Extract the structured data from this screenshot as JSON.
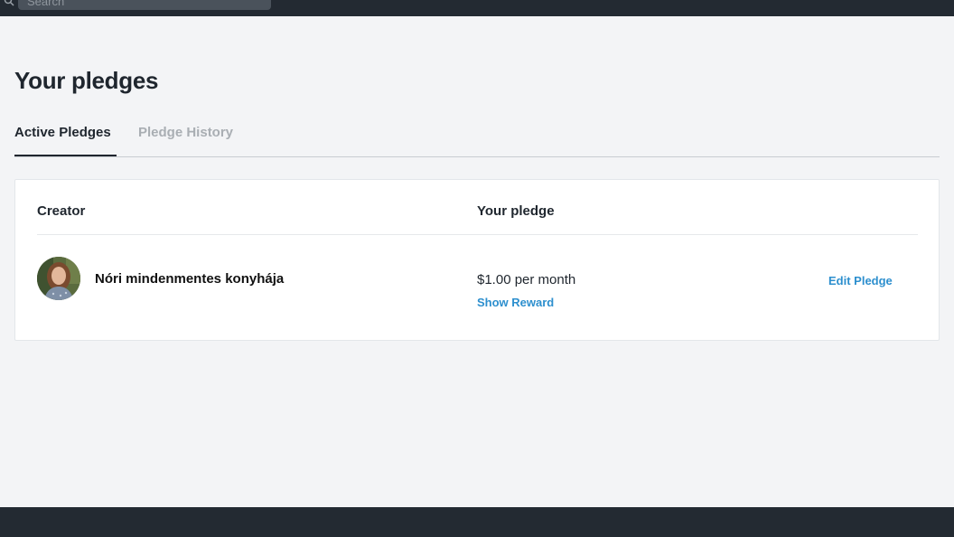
{
  "search": {
    "placeholder": "Search"
  },
  "page": {
    "title": "Your pledges"
  },
  "tabs": [
    {
      "label": "Active Pledges",
      "active": true
    },
    {
      "label": "Pledge History",
      "active": false
    }
  ],
  "table": {
    "headers": {
      "creator": "Creator",
      "pledge": "Your pledge"
    },
    "rows": [
      {
        "creator_name": "Nóri mindenmentes konyhája",
        "amount": "$1.00 per month",
        "show_reward_label": "Show Reward",
        "edit_label": "Edit Pledge"
      }
    ]
  },
  "colors": {
    "topbar": "#232a32",
    "background": "#f3f4f6",
    "link": "#2d8fce",
    "text": "#1f262e",
    "tab_inactive": "#a9aeb3"
  },
  "icons": {
    "search": "search-icon"
  }
}
